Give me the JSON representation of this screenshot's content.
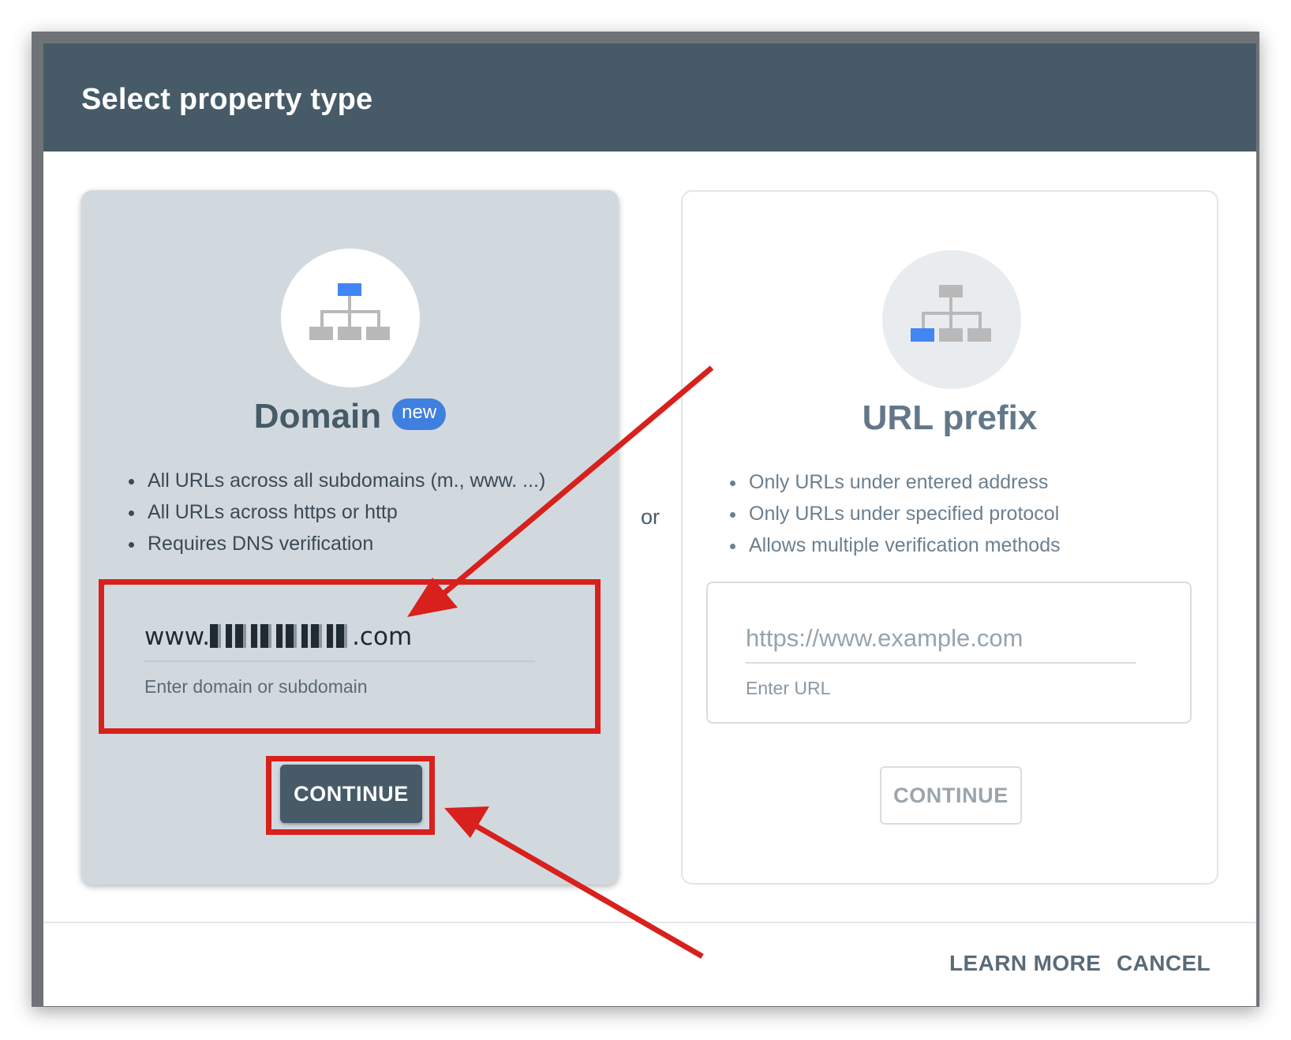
{
  "dialog": {
    "title": "Select property type"
  },
  "domain_card": {
    "heading": "Domain",
    "badge": "new",
    "features": [
      "All URLs across all subdomains (m., www. ...)",
      "All URLs across https or http",
      "Requires DNS verification"
    ],
    "input_prefix": "www.",
    "input_suffix": ".com",
    "input_helper": "Enter domain or subdomain",
    "continue_label": "CONTINUE"
  },
  "separator": {
    "label": "or"
  },
  "url_card": {
    "heading": "URL prefix",
    "features": [
      "Only URLs under entered address",
      "Only URLs under specified protocol",
      "Allows multiple verification methods"
    ],
    "input_placeholder": "https://www.example.com",
    "input_helper": "Enter URL",
    "continue_label": "CONTINUE"
  },
  "footer": {
    "learn_more_label": "LEARN MORE",
    "cancel_label": "CANCEL"
  },
  "colors": {
    "header_bg": "#465a67",
    "domain_card_bg": "#d2d9de",
    "accent_blue": "#3f7fe0",
    "annotation_red": "#d8201c"
  },
  "icons": {
    "domain_card_icon": "sitemap-icon",
    "url_card_icon": "sitemap-icon"
  }
}
